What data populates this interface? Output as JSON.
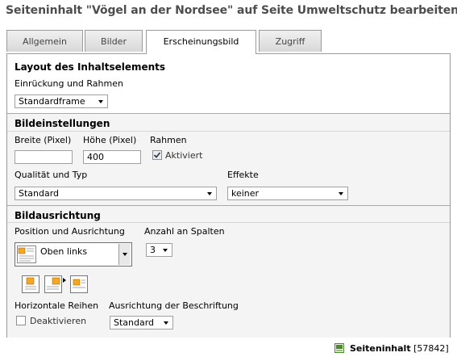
{
  "page_title": "Seiteninhalt \"Vögel an der Nordsee\" auf Seite Umweltschutz bearbeiten",
  "tabs": [
    {
      "label": "Allgemein",
      "active": false
    },
    {
      "label": "Bilder",
      "active": false
    },
    {
      "label": "Erscheinungsbild",
      "active": true
    },
    {
      "label": "Zugriff",
      "active": false
    }
  ],
  "layout": {
    "title": "Layout des Inhaltselements",
    "indent_label": "Einrückung und Rahmen",
    "indent_value": "Standardframe"
  },
  "image_settings": {
    "title": "Bildeinstellungen",
    "width_label": "Breite (Pixel)",
    "width_value": "",
    "height_label": "Höhe (Pixel)",
    "height_value": "400",
    "border_label": "Rahmen",
    "border_checkbox_label": "Aktiviert",
    "border_checked": true,
    "quality_label": "Qualität und Typ",
    "quality_value": "Standard",
    "effects_label": "Effekte",
    "effects_value": "keiner"
  },
  "image_alignment": {
    "title": "Bildausrichtung",
    "position_label": "Position und Ausrichtung",
    "position_value": "Oben links",
    "columns_label": "Anzahl an Spalten",
    "columns_value": "3",
    "rows_label": "Horizontale Reihen",
    "rows_checkbox_label": "Deaktivieren",
    "rows_checked": false,
    "caption_label": "Ausrichtung der Beschriftung",
    "caption_value": "Standard"
  },
  "footer": {
    "record_label": "Seiteninhalt",
    "record_id": "[57842]"
  },
  "colors": {
    "title_gray": "#4d4d4d",
    "thumb_orange": "#f5a623",
    "footer_icon_green": "#4a8a2a"
  }
}
